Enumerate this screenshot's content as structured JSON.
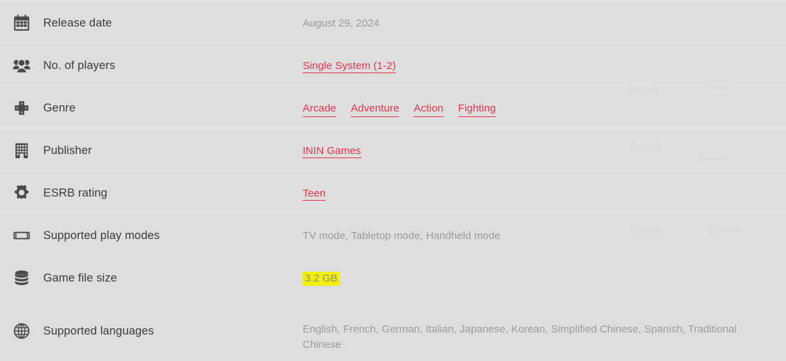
{
  "table": {
    "rows": [
      {
        "id": "release-date",
        "icon": "calendar-icon",
        "label": "Release date",
        "value": "August 29, 2024",
        "value_type": "text"
      },
      {
        "id": "no-of-players",
        "icon": "players-group-icon",
        "label": "No. of players",
        "value": "Single System (1-2)",
        "value_type": "link"
      },
      {
        "id": "genre",
        "icon": "dpad-icon",
        "label": "Genre",
        "value_type": "link-list",
        "links": [
          "Arcade",
          "Adventure",
          "Action",
          "Fighting"
        ]
      },
      {
        "id": "publisher",
        "icon": "building-icon",
        "label": "Publisher",
        "value": "ININ Games",
        "value_type": "link"
      },
      {
        "id": "esrb-rating",
        "icon": "gear-icon",
        "label": "ESRB rating",
        "value": "Teen",
        "value_type": "link"
      },
      {
        "id": "supported-play-modes",
        "icon": "handheld-console-icon",
        "label": "Supported play modes",
        "value": "TV mode, Tabletop mode, Handheld mode",
        "value_type": "text"
      },
      {
        "id": "game-file-size",
        "icon": "database-icon",
        "label": "Game file size",
        "value": "3.2 GB",
        "value_type": "highlighted"
      },
      {
        "id": "supported-languages",
        "icon": "globe-icon",
        "label": "Supported languages",
        "value": "English, French, German, Italian, Japanese, Korean, Simplified Chinese, Spanish, Traditional Chinese",
        "value_type": "text"
      }
    ]
  },
  "watermarks": [
    "Bestsoft",
    "Bestsoft",
    "Bestsoft",
    "Bestsoft",
    "Bestsoft",
    "Bestsoft"
  ],
  "colors": {
    "background": "#dedede",
    "divider": "#e9e9e9",
    "label_text": "#3c3c3c",
    "value_text": "#9b9b9b",
    "link_red": "#e4344b",
    "highlight_yellow": "#f2f200"
  }
}
